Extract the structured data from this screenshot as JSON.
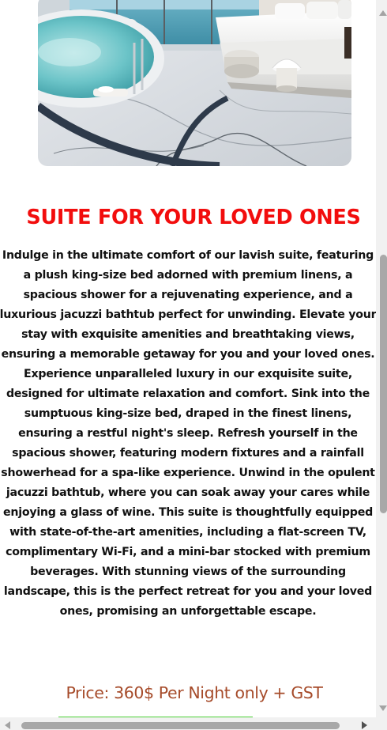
{
  "suite": {
    "image_alt": "Luxury suite with king-size bed and jacuzzi bathtub overlooking the sea",
    "title": "SUITE FOR YOUR LOVED ONES",
    "description": "Indulge in the ultimate comfort of our lavish suite, featuring a plush king-size bed adorned with premium linens, a spacious shower for a rejuvenating experience, and a luxurious jacuzzi bathtub perfect for unwinding. Elevate your stay with exquisite amenities and breathtaking views, ensuring a memorable getaway for you and your loved ones. Experience unparalleled luxury in our exquisite suite, designed for ultimate relaxation and comfort. Sink into the sumptuous king-size bed, draped in the finest linens, ensuring a restful night's sleep. Refresh yourself in the spacious shower, featuring modern fixtures and a rainfall showerhead for a spa-like experience. Unwind in the opulent jacuzzi bathtub, where you can soak away your cares while enjoying a glass of wine. This suite is thoughtfully equipped with state-of-the-art amenities, including a flat-screen TV, complimentary Wi-Fi, and a mini-bar stocked with premium beverages. With stunning views of the surrounding landscape, this is the perfect retreat for you and your loved ones, promising an unforgettable escape.",
    "price": "Price: 360$ Per Night only + GST"
  },
  "colors": {
    "title": "#f20d0d",
    "price": "#a64b2a",
    "underline": "#4cd137",
    "body_text": "#111111"
  },
  "icons": {
    "scroll_up": "triangle-up-icon",
    "scroll_down": "triangle-down-icon",
    "scroll_left": "triangle-left-icon",
    "scroll_right": "triangle-right-icon"
  }
}
